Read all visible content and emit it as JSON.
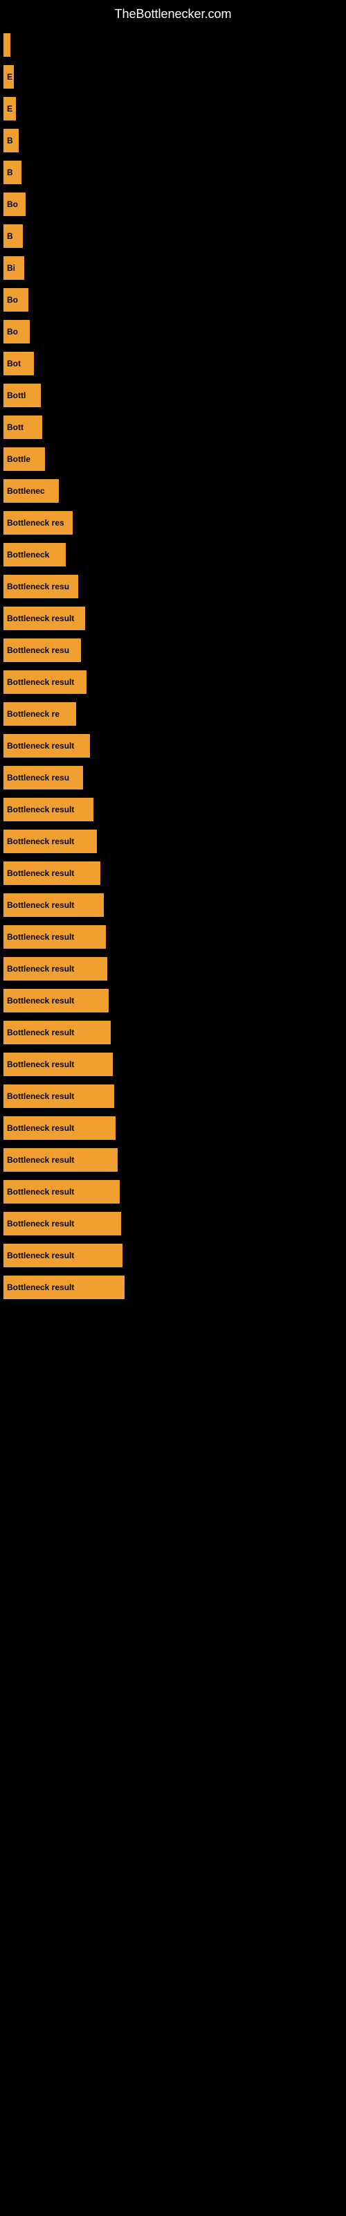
{
  "header": {
    "title": "TheBottlenecker.com"
  },
  "bars": [
    {
      "id": 1,
      "label": "",
      "width": 8
    },
    {
      "id": 2,
      "label": "E",
      "width": 15
    },
    {
      "id": 3,
      "label": "E",
      "width": 18
    },
    {
      "id": 4,
      "label": "B",
      "width": 22
    },
    {
      "id": 5,
      "label": "B",
      "width": 26
    },
    {
      "id": 6,
      "label": "Bo",
      "width": 32
    },
    {
      "id": 7,
      "label": "B",
      "width": 28
    },
    {
      "id": 8,
      "label": "Bi",
      "width": 30
    },
    {
      "id": 9,
      "label": "Bo",
      "width": 36
    },
    {
      "id": 10,
      "label": "Bo",
      "width": 38
    },
    {
      "id": 11,
      "label": "Bot",
      "width": 44
    },
    {
      "id": 12,
      "label": "Bottl",
      "width": 54
    },
    {
      "id": 13,
      "label": "Bott",
      "width": 56
    },
    {
      "id": 14,
      "label": "Bottle",
      "width": 60
    },
    {
      "id": 15,
      "label": "Bottlenec",
      "width": 80
    },
    {
      "id": 16,
      "label": "Bottleneck res",
      "width": 100
    },
    {
      "id": 17,
      "label": "Bottleneck",
      "width": 90
    },
    {
      "id": 18,
      "label": "Bottleneck resu",
      "width": 108
    },
    {
      "id": 19,
      "label": "Bottleneck result",
      "width": 118
    },
    {
      "id": 20,
      "label": "Bottleneck resu",
      "width": 112
    },
    {
      "id": 21,
      "label": "Bottleneck result",
      "width": 120
    },
    {
      "id": 22,
      "label": "Bottleneck re",
      "width": 105
    },
    {
      "id": 23,
      "label": "Bottleneck result",
      "width": 125
    },
    {
      "id": 24,
      "label": "Bottleneck resu",
      "width": 115
    },
    {
      "id": 25,
      "label": "Bottleneck result",
      "width": 130
    },
    {
      "id": 26,
      "label": "Bottleneck result",
      "width": 135
    },
    {
      "id": 27,
      "label": "Bottleneck result",
      "width": 140
    },
    {
      "id": 28,
      "label": "Bottleneck result",
      "width": 145
    },
    {
      "id": 29,
      "label": "Bottleneck result",
      "width": 148
    },
    {
      "id": 30,
      "label": "Bottleneck result",
      "width": 150
    },
    {
      "id": 31,
      "label": "Bottleneck result",
      "width": 152
    },
    {
      "id": 32,
      "label": "Bottleneck result",
      "width": 155
    },
    {
      "id": 33,
      "label": "Bottleneck result",
      "width": 158
    },
    {
      "id": 34,
      "label": "Bottleneck result",
      "width": 160
    },
    {
      "id": 35,
      "label": "Bottleneck result",
      "width": 162
    },
    {
      "id": 36,
      "label": "Bottleneck result",
      "width": 165
    },
    {
      "id": 37,
      "label": "Bottleneck result",
      "width": 168
    },
    {
      "id": 38,
      "label": "Bottleneck result",
      "width": 170
    },
    {
      "id": 39,
      "label": "Bottleneck result",
      "width": 172
    },
    {
      "id": 40,
      "label": "Bottleneck result",
      "width": 175
    }
  ]
}
